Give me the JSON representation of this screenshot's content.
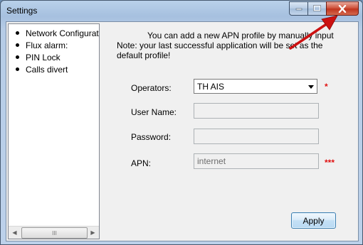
{
  "window": {
    "title": "Settings",
    "minimize_glyph": "",
    "maximize_glyph": "",
    "close_glyph": "X"
  },
  "sidebar": {
    "items": [
      {
        "label": "Network Configurati"
      },
      {
        "label": "Flux alarm:"
      },
      {
        "label": "PIN Lock"
      },
      {
        "label": "Calls divert"
      }
    ],
    "scroll_left": "◀",
    "scroll_right": "▶",
    "thumb_grip": "III"
  },
  "info": {
    "line1": "You can add a new APN profile by manually input",
    "line2": "Note: your last successful application will be set as the",
    "line3": "default profile!"
  },
  "form": {
    "operators_label": "Operators:",
    "operators_value": "TH AIS",
    "operators_required": "*",
    "username_label": "User Name:",
    "username_value": "",
    "password_label": "Password:",
    "password_value": "",
    "apn_label": "APN:",
    "apn_value": "internet",
    "apn_required": "***"
  },
  "buttons": {
    "apply": "Apply"
  },
  "colors": {
    "close_button": "#c0351f",
    "required_marker": "#e01010",
    "annotation_arrow": "#cc1111"
  }
}
